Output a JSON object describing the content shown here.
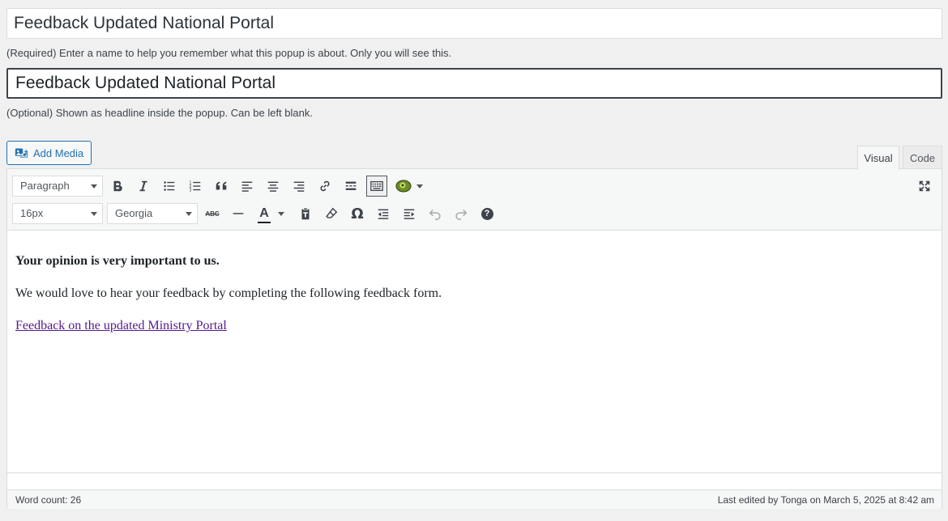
{
  "popup_name": {
    "value": "Feedback Updated National Portal",
    "help": "(Required) Enter a name to help you remember what this popup is about. Only you will see this."
  },
  "popup_headline": {
    "value": "Feedback Updated National Portal",
    "help": "(Optional) Shown as headline inside the popup. Can be left blank."
  },
  "media": {
    "add_media_label": "Add Media"
  },
  "tabs": {
    "visual": "Visual",
    "code": "Code"
  },
  "toolbar": {
    "format_select": "Paragraph",
    "font_size_select": "16px",
    "font_family_select": "Georgia",
    "strikethrough_glyph": "ABC",
    "text_color_glyph": "A",
    "special_char_glyph": "Ω",
    "help_glyph": "?"
  },
  "content": {
    "heading": "Your opinion is very important to us.",
    "paragraph": "We would love to hear your feedback by completing the following feedback form.",
    "link": "Feedback on the updated Ministry Portal"
  },
  "status": {
    "word_count": "Word count: 26",
    "last_edited": "Last edited by Tonga on March 5, 2025 at 8:42 am"
  },
  "colors": {
    "accent": "#2271b1",
    "link_visited": "#551a8b",
    "toolbar_bg": "#f6f7f7"
  },
  "icons": [
    "add-media-icon",
    "bold-icon",
    "italic-icon",
    "bullet-list-icon",
    "numbered-list-icon",
    "blockquote-icon",
    "align-left-icon",
    "align-center-icon",
    "align-right-icon",
    "link-icon",
    "read-more-icon",
    "toolbar-toggle-icon",
    "plugin-icon",
    "fullscreen-icon",
    "strikethrough-icon",
    "horizontal-line-icon",
    "text-color-icon",
    "paste-text-icon",
    "clear-formatting-icon",
    "special-character-icon",
    "outdent-icon",
    "indent-icon",
    "undo-icon",
    "redo-icon",
    "help-icon"
  ]
}
